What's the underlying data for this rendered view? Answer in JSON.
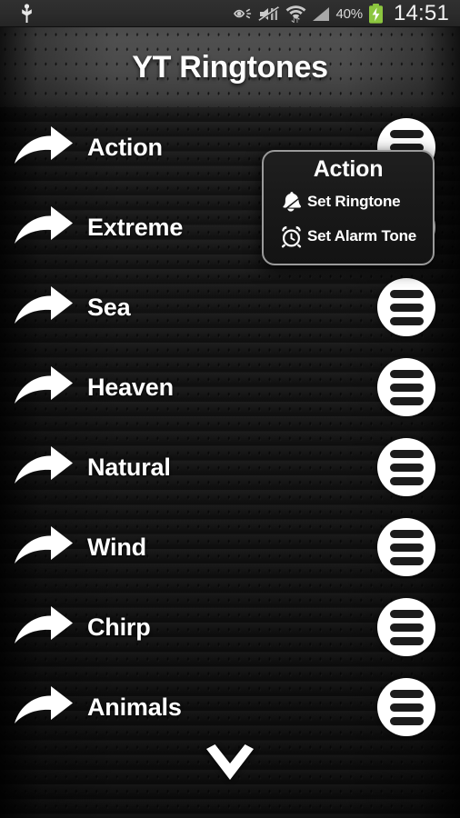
{
  "statusbar": {
    "usb_icon": "usb-icon",
    "eye_icon": "smart-stay-eye-icon",
    "mute_icon": "sound-muted-icon",
    "wifi_icon": "wifi-signal-icon",
    "cell_icon": "cellular-signal-icon",
    "battery_percent": "40%",
    "battery_icon": "battery-charging-icon",
    "clock": "14:51",
    "accent_green": "#8cc63f"
  },
  "header": {
    "title": "YT Ringtones"
  },
  "list": {
    "arrow_icon": "curved-arrow-right-icon",
    "menu_icon": "hamburger-menu-icon",
    "items": [
      {
        "label": "Action"
      },
      {
        "label": "Extreme"
      },
      {
        "label": "Sea"
      },
      {
        "label": "Heaven"
      },
      {
        "label": "Natural"
      },
      {
        "label": "Wind"
      },
      {
        "label": "Chirp"
      },
      {
        "label": "Animals"
      }
    ],
    "more_icon": "chevron-down-icon"
  },
  "popup": {
    "title": "Action",
    "items": [
      {
        "label": "Set Ringtone",
        "icon": "bell-icon"
      },
      {
        "label": "Set Alarm Tone",
        "icon": "alarm-clock-icon"
      }
    ]
  }
}
